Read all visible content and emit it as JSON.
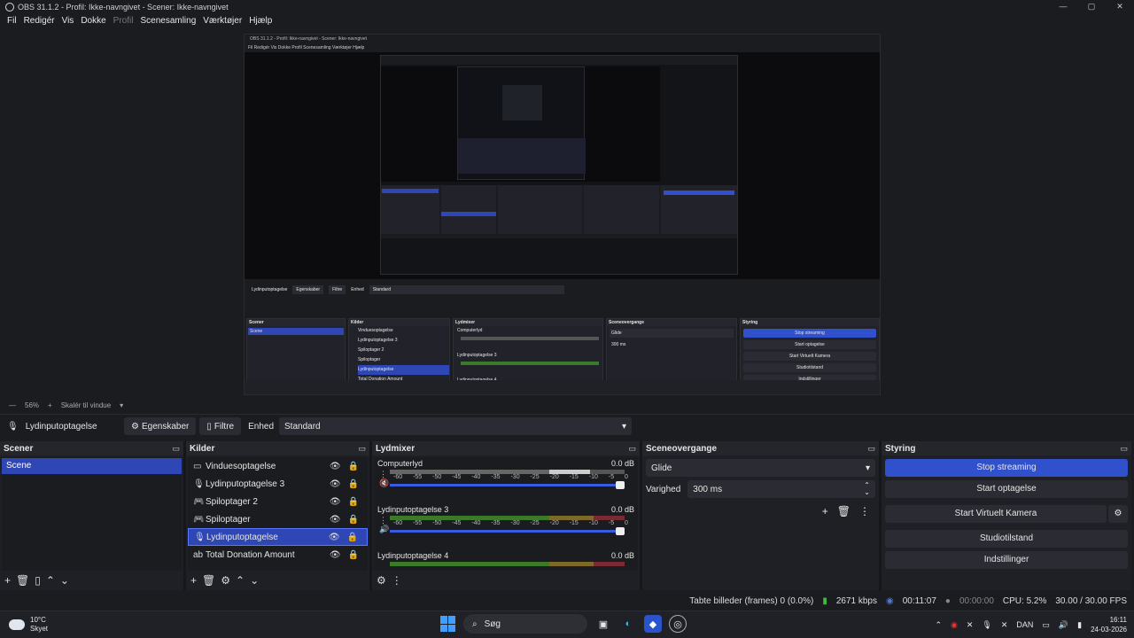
{
  "window": {
    "title": "OBS 31.1.2 - Profil: Ikke-navngivet - Scener: Ikke-navngivet",
    "controls": [
      "—",
      "▢",
      "✕"
    ]
  },
  "menu": {
    "items": [
      "Fil",
      "Redigér",
      "Vis",
      "Dokke",
      "Profil",
      "Scenesamling",
      "Værktøjer",
      "Hjælp"
    ]
  },
  "zoom": {
    "minus": "—",
    "value": "56%",
    "plus": "+",
    "scale_label": "Skalér til vindue"
  },
  "source_toolbar": {
    "source_name": "Lydinputoptagelse",
    "properties": "Egenskaber",
    "filters": "Filtre",
    "device_label": "Enhed",
    "device_value": "Standard"
  },
  "scenes": {
    "title": "Scener",
    "items": [
      "Scene"
    ]
  },
  "sources": {
    "title": "Kilder",
    "items": [
      {
        "label": "Vinduesoptagelse",
        "icon": "window-icon"
      },
      {
        "label": "Lydinputoptagelse 3",
        "icon": "mic-icon"
      },
      {
        "label": "Spiloptager 2",
        "icon": "gamepad-icon"
      },
      {
        "label": "Spiloptager",
        "icon": "gamepad-icon"
      },
      {
        "label": "Lydinputoptagelse",
        "icon": "mic-icon"
      },
      {
        "label": "Total Donation Amount",
        "icon": "text-icon"
      }
    ]
  },
  "mixer": {
    "title": "Lydmixer",
    "channels": [
      {
        "name": "Computerlyd",
        "db": "0.0 dB"
      },
      {
        "name": "Lydinputoptagelse 3",
        "db": "0.0 dB"
      },
      {
        "name": "Lydinputoptagelse 4",
        "db": "0.0 dB"
      }
    ],
    "ticks": [
      "-60",
      "-55",
      "-50",
      "-45",
      "-40",
      "-35",
      "-30",
      "-25",
      "-20",
      "-15",
      "-10",
      "-5",
      "0"
    ]
  },
  "transitions": {
    "title": "Sceneovergange",
    "type": "Glide",
    "duration_label": "Varighed",
    "duration_value": "300 ms"
  },
  "controls": {
    "title": "Styring",
    "stop_streaming": "Stop streaming",
    "start_recording": "Start optagelse",
    "start_virtual_cam": "Start Virtuelt Kamera",
    "studio_mode": "Studiotilstand",
    "settings": "Indstillinger"
  },
  "status": {
    "dropped": "Tabte billeder (frames) 0 (0.0%)",
    "bitrate": "2671 kbps",
    "stream_time": "00:11:07",
    "rec_time": "00:00:00",
    "cpu": "CPU: 5.2%",
    "fps": "30.00 / 30.00 FPS"
  },
  "taskbar": {
    "temp": "10°C",
    "weather": "Skyet",
    "search": "Søg",
    "lang": "DAN",
    "time": "16:11",
    "date": "24-03-2026"
  },
  "nested": {
    "title": "OBS 31.1.2 - Profil: Ikke-navngivet - Scener: Ikke-navngivet",
    "menu": "Fil   Redigér   Vis   Dokke   Profil   Scenesamling   Værktøjer   Hjælp"
  },
  "colors": {
    "accent": "#2e47b5",
    "button_blue": "#3050cc",
    "background": "#1b1c20",
    "panel": "#1f2025"
  }
}
